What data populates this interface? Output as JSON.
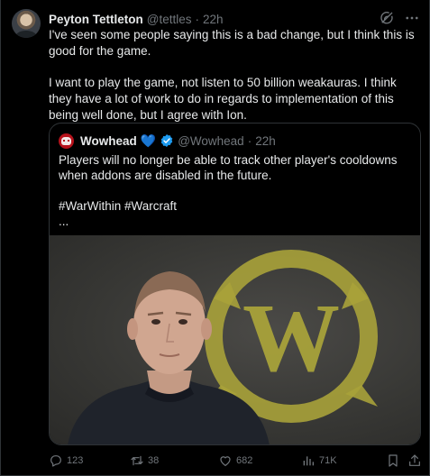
{
  "tweet": {
    "author_name": "Peyton Tettleton",
    "author_handle": "@tettles",
    "separator": "·",
    "time": "22h",
    "paragraphs": [
      "I've seen some people saying this is a bad change, but I think this is good for the game.",
      "I want to play the game, not listen to 50 billion weakauras. I think they have a lot of work to do in regards to implementation of this being well done, but I agree with Ion."
    ]
  },
  "quoted": {
    "author_name": "Wowhead",
    "name_emoji": "💙",
    "author_handle": "@Wowhead",
    "separator": "·",
    "time": "22h",
    "text": "Players will no longer be able to track other player's cooldowns when addons are disabled in the future.",
    "hashtags": "#WarWithin #Warcraft",
    "truncation": "...",
    "media_logo_letter": "W"
  },
  "actions": {
    "replies": "123",
    "reposts": "38",
    "likes": "682",
    "views": "71K"
  },
  "icons": {
    "grok": "grok-icon",
    "more": "more-icon",
    "verified": "verified-badge-icon",
    "reply": "reply-icon",
    "repost": "repost-icon",
    "like": "heart-icon",
    "views": "views-icon",
    "bookmark": "bookmark-icon",
    "share": "share-icon"
  },
  "colors": {
    "background": "#000000",
    "text": "#e7e9ea",
    "muted": "#71767b",
    "border": "#2f3336",
    "verified": "#1d9bf0",
    "logo": "#a8a23a"
  }
}
